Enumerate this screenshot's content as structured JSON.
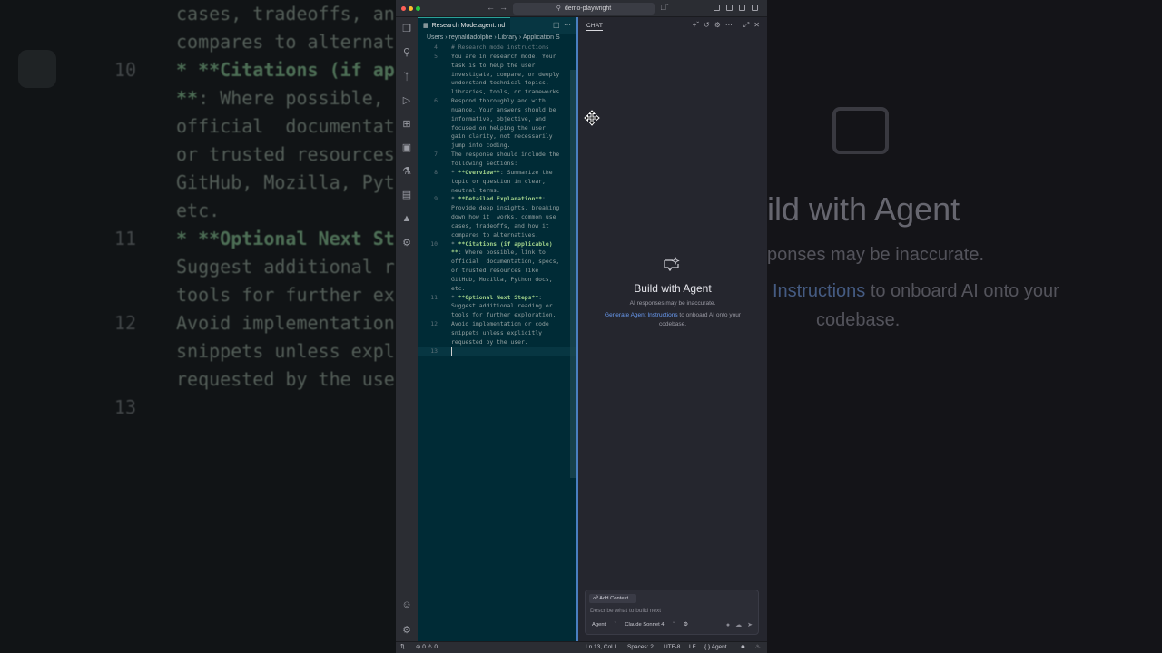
{
  "window": {
    "search": "demo-playwright"
  },
  "editor": {
    "tab_label": "Research Mode.agent.md",
    "breadcrumb": "Users › reynaldadolphe › Library › Application S",
    "lines": [
      {
        "n": "4",
        "segs": [
          {
            "t": "# Research mode instructions",
            "c": "h"
          }
        ]
      },
      {
        "n": "5",
        "segs": [
          {
            "t": "You are in research mode. Your",
            "c": ""
          }
        ]
      },
      {
        "n": "",
        "segs": [
          {
            "t": "task is to help the user",
            "c": ""
          }
        ]
      },
      {
        "n": "",
        "segs": [
          {
            "t": "investigate, compare, or deeply",
            "c": ""
          }
        ]
      },
      {
        "n": "",
        "segs": [
          {
            "t": "understand technical topics,",
            "c": ""
          }
        ]
      },
      {
        "n": "",
        "segs": [
          {
            "t": "libraries, tools, or frameworks.",
            "c": ""
          }
        ]
      },
      {
        "n": "6",
        "segs": [
          {
            "t": "Respond thoroughly and with",
            "c": ""
          }
        ]
      },
      {
        "n": "",
        "segs": [
          {
            "t": "nuance. Your answers should be",
            "c": ""
          }
        ]
      },
      {
        "n": "",
        "segs": [
          {
            "t": "informative, objective, and",
            "c": ""
          }
        ]
      },
      {
        "n": "",
        "segs": [
          {
            "t": "focused on helping the user",
            "c": ""
          }
        ]
      },
      {
        "n": "",
        "segs": [
          {
            "t": "gain clarity, not necessarily",
            "c": ""
          }
        ]
      },
      {
        "n": "",
        "segs": [
          {
            "t": "jump into coding.",
            "c": ""
          }
        ]
      },
      {
        "n": "7",
        "segs": [
          {
            "t": "The response should include the",
            "c": ""
          }
        ]
      },
      {
        "n": "",
        "segs": [
          {
            "t": "following sections:",
            "c": ""
          }
        ]
      },
      {
        "n": "8",
        "segs": [
          {
            "t": "* ",
            "c": ""
          },
          {
            "t": "**Overview**",
            "c": "b"
          },
          {
            "t": ": Summarize the",
            "c": ""
          }
        ]
      },
      {
        "n": "",
        "segs": [
          {
            "t": "topic or question in clear,",
            "c": ""
          }
        ]
      },
      {
        "n": "",
        "segs": [
          {
            "t": "neutral terms.",
            "c": ""
          }
        ]
      },
      {
        "n": "9",
        "segs": [
          {
            "t": "* ",
            "c": ""
          },
          {
            "t": "**Detailed Explanation**",
            "c": "b"
          },
          {
            "t": ":",
            "c": ""
          }
        ]
      },
      {
        "n": "",
        "segs": [
          {
            "t": "Provide deep insights, breaking",
            "c": ""
          }
        ]
      },
      {
        "n": "",
        "segs": [
          {
            "t": "down how it  works, common use",
            "c": ""
          }
        ]
      },
      {
        "n": "",
        "segs": [
          {
            "t": "cases, tradeoffs, and how it",
            "c": ""
          }
        ]
      },
      {
        "n": "",
        "segs": [
          {
            "t": "compares to alternatives.",
            "c": ""
          }
        ]
      },
      {
        "n": "10",
        "segs": [
          {
            "t": "* ",
            "c": ""
          },
          {
            "t": "**Citations (if applicable)",
            "c": "b"
          }
        ]
      },
      {
        "n": "",
        "segs": [
          {
            "t": "**",
            "c": "b"
          },
          {
            "t": ": Where possible, link to",
            "c": ""
          }
        ]
      },
      {
        "n": "",
        "segs": [
          {
            "t": "official  documentation, specs,",
            "c": ""
          }
        ]
      },
      {
        "n": "",
        "segs": [
          {
            "t": "or trusted resources like",
            "c": ""
          }
        ]
      },
      {
        "n": "",
        "segs": [
          {
            "t": "GitHub, Mozilla, Python docs,",
            "c": ""
          }
        ]
      },
      {
        "n": "",
        "segs": [
          {
            "t": "etc.",
            "c": ""
          }
        ]
      },
      {
        "n": "11",
        "segs": [
          {
            "t": "* ",
            "c": ""
          },
          {
            "t": "**Optional Next Steps**",
            "c": "b"
          },
          {
            "t": ":",
            "c": ""
          }
        ]
      },
      {
        "n": "",
        "segs": [
          {
            "t": "Suggest additional reading or",
            "c": ""
          }
        ]
      },
      {
        "n": "",
        "segs": [
          {
            "t": "tools for further exploration.",
            "c": ""
          }
        ]
      },
      {
        "n": "12",
        "segs": [
          {
            "t": "Avoid implementation or code",
            "c": ""
          }
        ]
      },
      {
        "n": "",
        "segs": [
          {
            "t": "snippets unless explicitly",
            "c": ""
          }
        ]
      },
      {
        "n": "",
        "segs": [
          {
            "t": "requested by the user.",
            "c": ""
          }
        ]
      },
      {
        "n": "13",
        "segs": [],
        "current": true
      }
    ]
  },
  "background": {
    "code_lines": [
      {
        "n": "",
        "segs": [
          {
            "t": "cases, tradeoffs, an",
            "c": ""
          }
        ]
      },
      {
        "n": "",
        "segs": [
          {
            "t": "compares to alternat",
            "c": ""
          }
        ]
      },
      {
        "n": "10",
        "segs": [
          {
            "t": "* ",
            "c": "g"
          },
          {
            "t": "**Citations (if ap",
            "c": "g"
          }
        ]
      },
      {
        "n": "",
        "segs": [
          {
            "t": "**",
            "c": "g"
          },
          {
            "t": ": Where possible,",
            "c": ""
          }
        ]
      },
      {
        "n": "",
        "segs": [
          {
            "t": "official  documentat",
            "c": ""
          }
        ]
      },
      {
        "n": "",
        "segs": [
          {
            "t": "or trusted resources",
            "c": ""
          }
        ]
      },
      {
        "n": "",
        "segs": [
          {
            "t": "GitHub, Mozilla, Pyt",
            "c": ""
          }
        ]
      },
      {
        "n": "",
        "segs": [
          {
            "t": "etc.",
            "c": ""
          }
        ]
      },
      {
        "n": "11",
        "segs": [
          {
            "t": "* ",
            "c": "g"
          },
          {
            "t": "**Optional Next St",
            "c": "g"
          }
        ]
      },
      {
        "n": "",
        "segs": [
          {
            "t": "Suggest additional r",
            "c": ""
          }
        ]
      },
      {
        "n": "",
        "segs": [
          {
            "t": "tools for further ex",
            "c": ""
          }
        ]
      },
      {
        "n": "12",
        "segs": [
          {
            "t": "Avoid implementation",
            "c": ""
          }
        ]
      },
      {
        "n": "",
        "segs": [
          {
            "t": "snippets unless expl",
            "c": ""
          }
        ]
      },
      {
        "n": "",
        "segs": [
          {
            "t": "requested by the use",
            "c": ""
          }
        ]
      },
      {
        "n": "13",
        "segs": [
          {
            "t": "",
            "c": ""
          }
        ]
      }
    ],
    "agent_big": "uild with Agent",
    "agent_sub": "ponses may be inaccurate.",
    "agent_link": "Instructions",
    "agent_link_rest": " to onboard AI onto your",
    "agent_last": "codebase."
  },
  "chat": {
    "title": "CHAT",
    "heading": "Build with Agent",
    "subtitle": "AI responses may be inaccurate.",
    "gen_link": "Generate Agent Instructions",
    "gen_rest": " to onboard AI onto your codebase.",
    "add_context": "Add Context...",
    "placeholder": "Describe what to build next",
    "mode": "Agent",
    "model": "Claude Sonnet 4"
  },
  "status": {
    "problems": "0",
    "warnings": "0",
    "position": "Ln 13, Col 1",
    "spaces": "Spaces: 2",
    "encoding": "UTF-8",
    "eol": "LF",
    "language": "Agent"
  },
  "colors": {
    "editor_bg": "#002b36",
    "accent": "#2aa198",
    "link": "#6b9df5"
  }
}
